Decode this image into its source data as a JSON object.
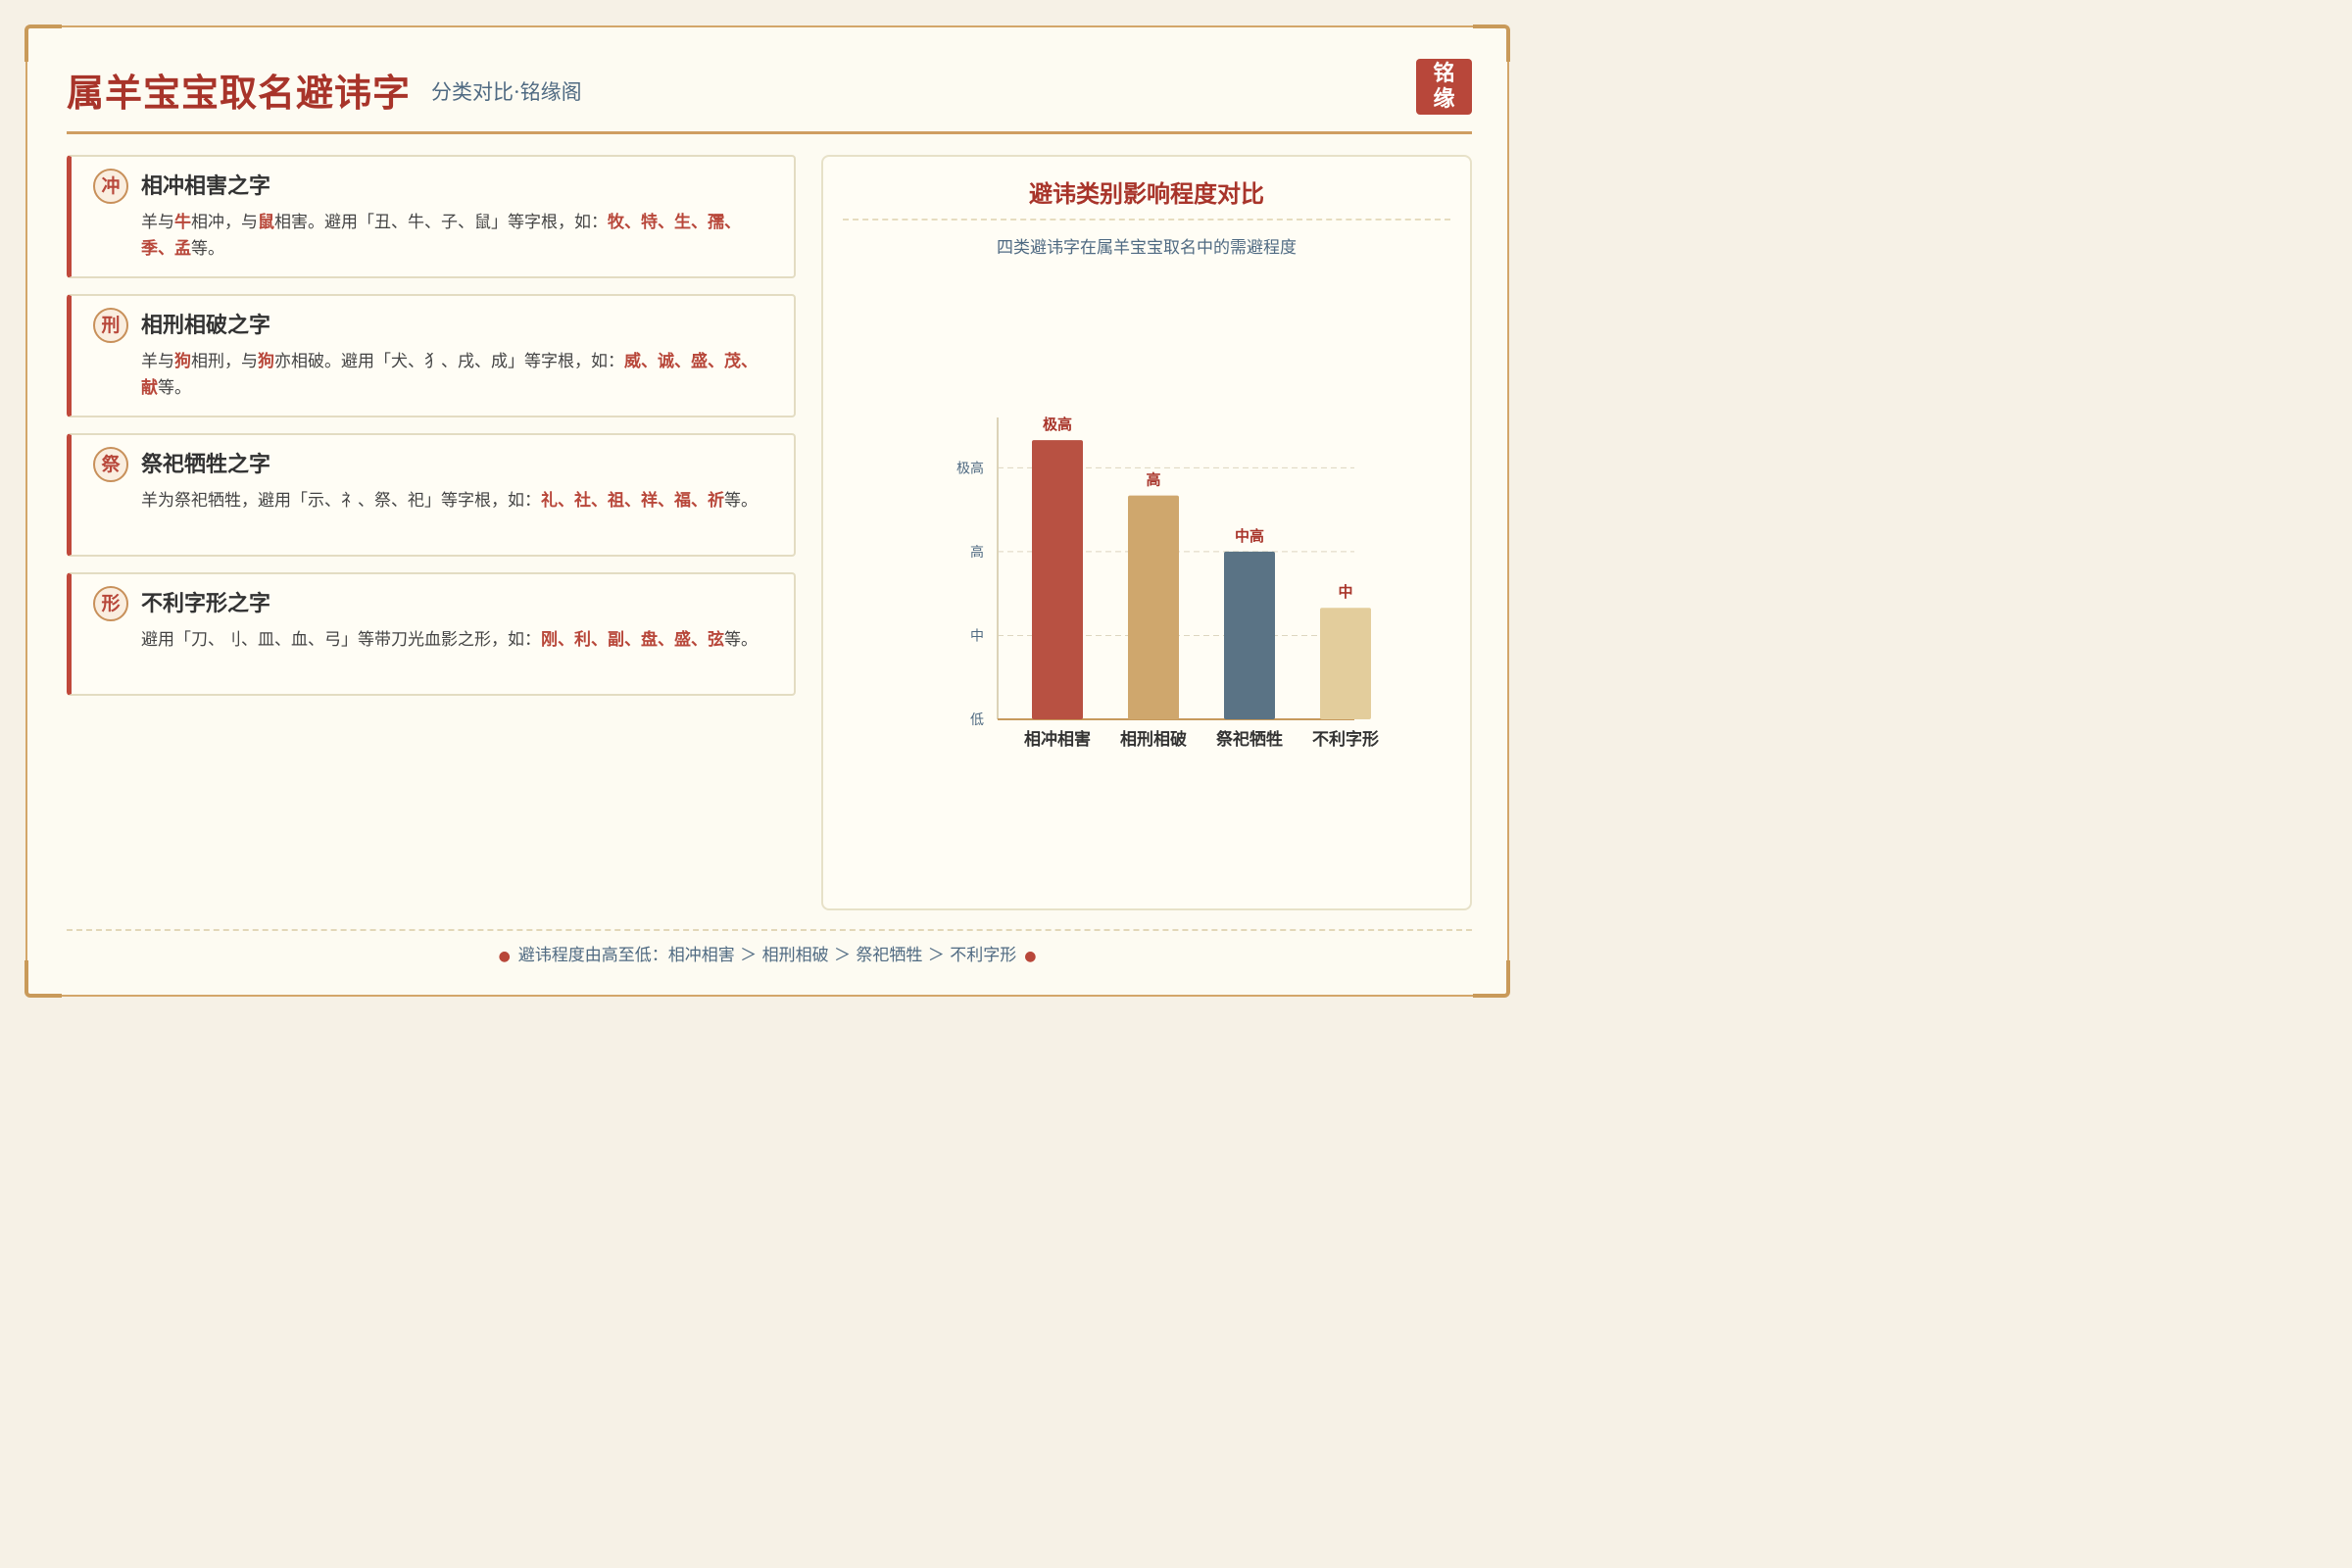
{
  "header": {
    "title": "属羊宝宝取名避讳字",
    "subtitle": "分类对比·铭缘阁",
    "seal_line1": "铭",
    "seal_line2": "缘"
  },
  "cards": [
    {
      "badge": "冲",
      "title": "相冲相害之字",
      "desc_parts": [
        {
          "t": "羊与",
          "hl": false
        },
        {
          "t": "牛",
          "hl": true
        },
        {
          "t": "相冲，与",
          "hl": false
        },
        {
          "t": "鼠",
          "hl": true
        },
        {
          "t": "相害。避用「丑、牛、子、鼠」等字根，如：",
          "hl": false
        },
        {
          "t": "牧、特、生、孺、季、孟",
          "hl": true
        },
        {
          "t": "等。",
          "hl": false
        }
      ]
    },
    {
      "badge": "刑",
      "title": "相刑相破之字",
      "desc_parts": [
        {
          "t": "羊与",
          "hl": false
        },
        {
          "t": "狗",
          "hl": true
        },
        {
          "t": "相刑，与",
          "hl": false
        },
        {
          "t": "狗",
          "hl": true
        },
        {
          "t": "亦相破。避用「犬、犭、戌、成」等字根，如：",
          "hl": false
        },
        {
          "t": "威、诚、盛、茂、献",
          "hl": true
        },
        {
          "t": "等。",
          "hl": false
        }
      ]
    },
    {
      "badge": "祭",
      "title": "祭祀牺牲之字",
      "desc_parts": [
        {
          "t": "羊为祭祀牺牲，避用「示、礻、祭、祀」等字根，如：",
          "hl": false
        },
        {
          "t": "礼、社、祖、祥、福、祈",
          "hl": true
        },
        {
          "t": "等。",
          "hl": false
        }
      ]
    },
    {
      "badge": "形",
      "title": "不利字形之字",
      "desc_parts": [
        {
          "t": "避用「刀、刂、皿、血、弓」等带刀光血影之形，如：",
          "hl": false
        },
        {
          "t": "刚、利、副、盘、盛、弦",
          "hl": true
        },
        {
          "t": "等。",
          "hl": false
        }
      ]
    }
  ],
  "panel": {
    "title": "避讳类别影响程度对比",
    "subtitle": "四类避讳字在属羊宝宝取名中的需避程度"
  },
  "chart_data": {
    "type": "bar",
    "title": "避讳类别影响程度对比",
    "subtitle": "四类避讳字在属羊宝宝取名中的需避程度",
    "categories": [
      "相冲相害",
      "相刑相破",
      "祭祀牺牲",
      "不利字形"
    ],
    "values": [
      3.33,
      2.67,
      2.0,
      1.33
    ],
    "data_labels": [
      "极高",
      "高",
      "中高",
      "中"
    ],
    "colors": [
      "#b85142",
      "#cfa76d",
      "#5a7385",
      "#e3cd9c"
    ],
    "y_ticks": [
      {
        "value": 0,
        "label": "低"
      },
      {
        "value": 1,
        "label": "中"
      },
      {
        "value": 2,
        "label": "高"
      },
      {
        "value": 3,
        "label": "极高"
      }
    ],
    "ylim": [
      0,
      3.6
    ],
    "grid": true,
    "xlabel": "",
    "ylabel": ""
  },
  "footer": {
    "text": "避讳程度由高至低：相冲相害 ＞ 相刑相破 ＞ 祭祀牺牲 ＞ 不利字形"
  },
  "colors": {
    "accent": "#a8342a",
    "gold": "#cf9d62",
    "muted_blue": "#4f6a82"
  }
}
